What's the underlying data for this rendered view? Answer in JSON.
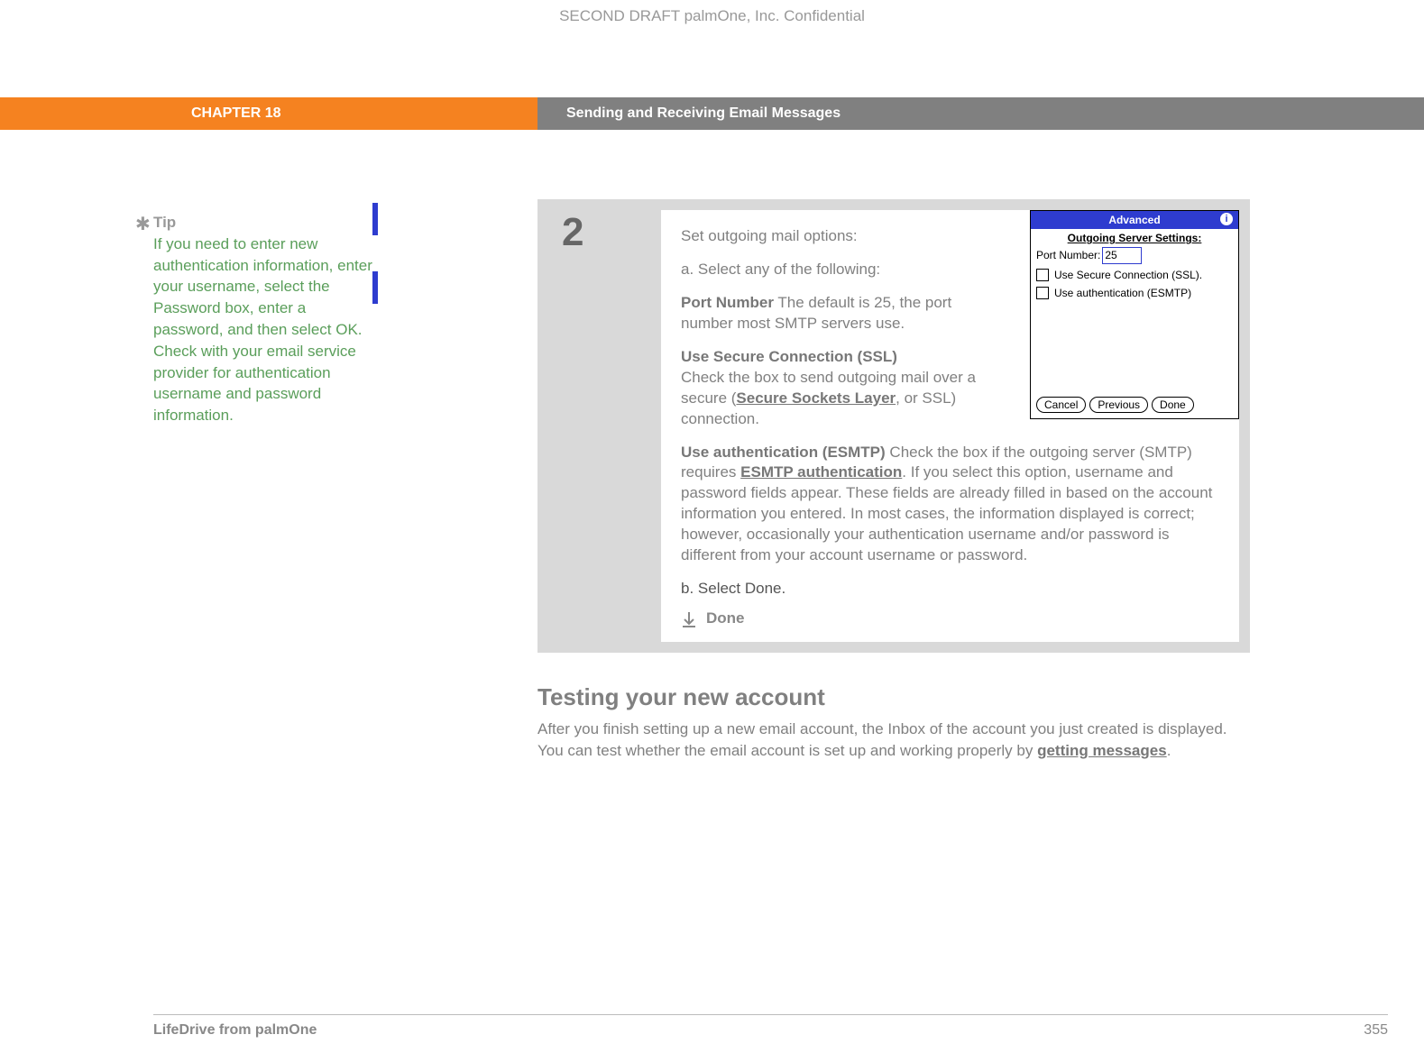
{
  "confidential": "SECOND DRAFT palmOne, Inc.  Confidential",
  "chapter": "CHAPTER 18",
  "title": "Sending and Receiving Email Messages",
  "tip": {
    "heading": "Tip",
    "body": "If you need to enter new authentication information, enter your username, select the Password box, enter a password, and then select OK. Check with your email service provider for authentication username and password information."
  },
  "step_number": "2",
  "step": {
    "intro": "Set outgoing mail options:",
    "a": "a.  Select any of the following:",
    "port_label": "Port Number",
    "port_text": "   The default is 25, the port number most SMTP servers use.",
    "ssl_label": "Use Secure Connection (SSL)",
    "ssl_text_a": "Check the box to send outgoing mail over a secure (",
    "ssl_link": "Secure Sockets Layer",
    "ssl_text_b": ", or SSL) connection.",
    "esmtp_label": "Use authentication (ESMTP)",
    "esmtp_text_a": "   Check the box if the outgoing server (SMTP) requires ",
    "esmtp_link": "ESMTP authentication",
    "esmtp_text_b": ". If you select this option, username and password fields appear. These fields are already filled in based on the account information you entered. In most cases, the information displayed is correct; however, occasionally your authentication username and/or password is different from your account username or password.",
    "b": "b.  Select Done.",
    "done": "Done"
  },
  "palm": {
    "title": "Advanced",
    "subtitle": "Outgoing Server Settings:",
    "port_label": "Port Number:",
    "port_value": "25",
    "chk1": "Use Secure Connection (SSL).",
    "chk2": "Use authentication (ESMTP)",
    "buttons": {
      "cancel": "Cancel",
      "previous": "Previous",
      "done": "Done"
    }
  },
  "section": {
    "heading": "Testing your new account",
    "text_a": "After you finish setting up a new email account, the Inbox of the account you just created is displayed. You can test whether the email account is set up and working properly by ",
    "link": "getting messages",
    "text_b": "."
  },
  "footer": {
    "product": "LifeDrive from palmOne",
    "page": "355"
  }
}
